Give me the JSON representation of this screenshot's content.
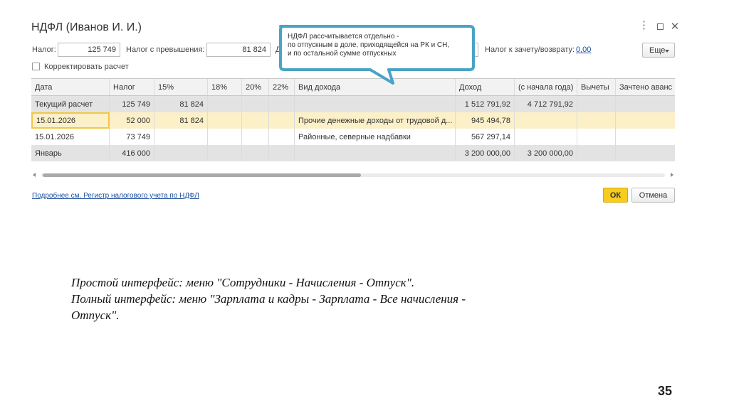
{
  "window": {
    "title": "НДФЛ (Иванов И. И.)",
    "controls": {
      "menu": "⋮",
      "minimize": "_",
      "close": "✕"
    }
  },
  "fields": {
    "tax_label": "Налог:",
    "tax_value": "125 749",
    "excess_label": "Налог с превышения:",
    "excess_value": "81 824",
    "partial_label": "Д",
    "offset_label": "Налог к зачету/возврату:",
    "offset_value": "0,00",
    "more_button": "Еще"
  },
  "checkbox": {
    "label": "Корректировать расчет",
    "checked": false
  },
  "tooltip": {
    "lines": [
      "НДФЛ рассчитывается отдельно -",
      "по отпускным в доле, приходящейся на РК и СН,",
      "и по остальной сумме отпускных"
    ],
    "border_color": "#4ba3c7"
  },
  "table": {
    "columns": [
      "Дата",
      "Налог",
      "15%",
      "18%",
      "20%",
      "22%",
      "Вид дохода",
      "Доход",
      "(с начала года)",
      "Вычеты",
      "Зачтено аванс"
    ],
    "rows": [
      {
        "cells": [
          "Текущий расчет",
          "125 749",
          "81 824",
          "",
          "",
          "",
          "",
          "1 512 791,92",
          "4 712 791,92",
          "",
          ""
        ],
        "style": "gray"
      },
      {
        "cells": [
          "15.01.2026",
          "52 000",
          "81 824",
          "",
          "",
          "",
          "Прочие денежные доходы от трудовой д...",
          "945 494,78",
          "",
          "",
          ""
        ],
        "style": "sel"
      },
      {
        "cells": [
          "15.01.2026",
          "73 749",
          "",
          "",
          "",
          "",
          "Районные, северные надбавки",
          "567 297,14",
          "",
          "",
          ""
        ],
        "style": "white"
      },
      {
        "cells": [
          "Январь",
          "416 000",
          "",
          "",
          "",
          "",
          "",
          "3 200 000,00",
          "3 200 000,00",
          "",
          ""
        ],
        "style": "gray"
      }
    ],
    "scroll_progress": 0.5
  },
  "footer": {
    "link": "Подробнее см. Регистр налогового учета по НДФЛ",
    "ok": "ОК",
    "cancel": "Отмена"
  },
  "caption": {
    "line1": "Простой интерфейс: меню \"Сотрудники - Начисления - Отпуск\".",
    "line2": "Полный интерфейс: меню \"Зарплата и кадры - Зарплата - Все начисления -",
    "line3": "Отпуск\"."
  },
  "page_number": "35",
  "colors": {
    "accent_ok": "#f6cc1e",
    "selected_row": "#fbf0c8",
    "link": "#1c4fa0"
  }
}
